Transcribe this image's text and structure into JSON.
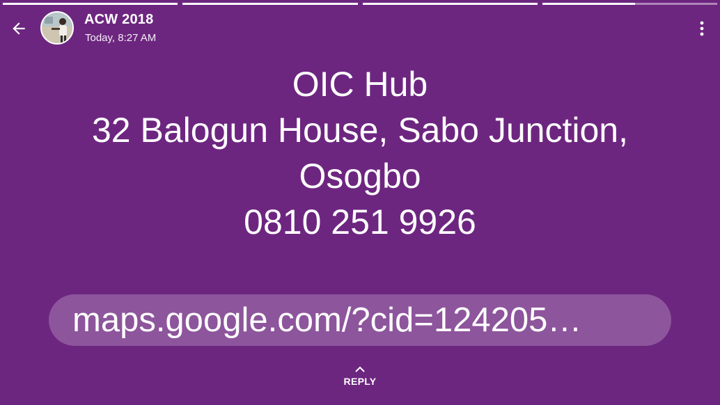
{
  "progress": {
    "segments": [
      1,
      1,
      1,
      0.53
    ]
  },
  "header": {
    "back_icon": "arrow-back-icon",
    "sender": "ACW 2018",
    "time": "Today, 8:27 AM",
    "menu_icon": "more-vert-icon"
  },
  "status": {
    "text": "OIC Hub\n32 Balogun House, Sabo Junction,\nOsogbo\n0810 251 9926",
    "background_color": "#6d2680"
  },
  "link": {
    "text": "maps.google.com/?cid=124205…"
  },
  "reply": {
    "icon": "chevron-up-icon",
    "label": "REPLY"
  }
}
